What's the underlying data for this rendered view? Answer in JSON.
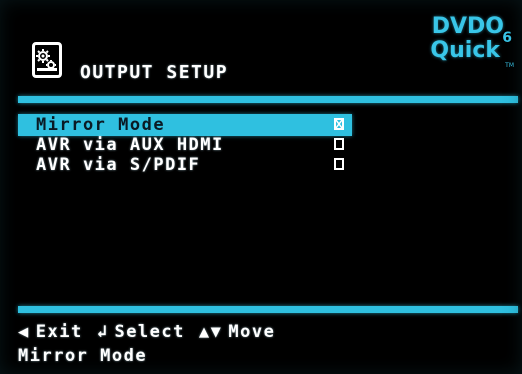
{
  "header": {
    "title": "OUTPUT SETUP",
    "icon": "settings-gear-icon"
  },
  "logo": {
    "line1": "DVDO",
    "line2": "Quick",
    "sub": "6",
    "tm": "TM",
    "color": "#39c6e8"
  },
  "colors": {
    "accent": "#2fc0e0",
    "text": "#ffffff",
    "background": "#000000"
  },
  "menu": {
    "items": [
      {
        "label": "Mirror Mode",
        "checked": true,
        "selected": true
      },
      {
        "label": "AVR via AUX HDMI",
        "checked": false,
        "selected": false
      },
      {
        "label": "AVR via S/PDIF",
        "checked": false,
        "selected": false
      }
    ]
  },
  "footer": {
    "hints": [
      {
        "icon": "◀",
        "icon_name": "left-arrow-icon",
        "label": "Exit"
      },
      {
        "icon": "↲",
        "icon_name": "enter-icon",
        "label": "Select"
      },
      {
        "icon": "▲▼",
        "icon_name": "up-down-arrows-icon",
        "label": "Move"
      }
    ],
    "status": "Mirror Mode"
  }
}
